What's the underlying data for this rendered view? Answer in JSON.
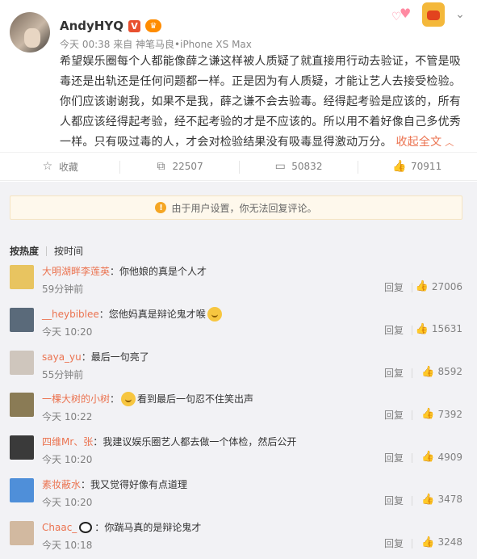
{
  "post": {
    "username": "AndyHYQ",
    "v_badge": "V",
    "vip_badge": "♛",
    "meta": "今天 00:38 来自 神笔马良•iPhone XS Max",
    "text": "希望娱乐圈每个人都能像薛之谦这样被人质疑了就直接用行动去验证，不管是吸毒还是出轨还是任何问题都一样。正是因为有人质疑，才能让艺人去接受检验。你们应该谢谢我，如果不是我，薛之谦不会去验毒。经得起考验是应该的，所有人都应该经得起考验，经不起考验的才是不应该的。所以用不着好像自己多优秀一样。只有吸过毒的人，才会对检验结果没有吸毒显得激动万分。",
    "fold_label": "收起全文",
    "icons": {
      "avatar": "user-avatar",
      "heart": "heart-decoration",
      "fox": "fox-mascot-icon",
      "more": "chevron-down-icon"
    }
  },
  "actions": [
    {
      "name": "favorite",
      "icon": "star-icon",
      "label": "收藏"
    },
    {
      "name": "repost",
      "icon": "repost-icon",
      "label": "22507"
    },
    {
      "name": "comment",
      "icon": "comment-icon",
      "label": "50832"
    },
    {
      "name": "like",
      "icon": "thumbs-up-icon",
      "label": "70911"
    }
  ],
  "notice": {
    "text": "由于用户设置，你无法回复评论。",
    "icon": "warning-icon"
  },
  "sort_tabs": {
    "hot": "按热度",
    "time": "按时间"
  },
  "reply_label": "回复",
  "comments": [
    {
      "user": "大明湖畔李莲英",
      "text": "你他娘的真是个人才",
      "time": "59分钟前",
      "likes": "27006",
      "avatar_color": "#e8c460",
      "emoji": ""
    },
    {
      "user": "__heybiblee",
      "text": "您他妈真是辩论鬼才喉",
      "time": "今天 10:20",
      "likes": "15631",
      "avatar_color": "#5a6a7a",
      "emoji": "grin-emoji"
    },
    {
      "user": "saya_yu",
      "text": "最后一句亮了",
      "time": "55分钟前",
      "likes": "8592",
      "avatar_color": "#cfc6bd",
      "emoji": ""
    },
    {
      "user": "一棵大树的小树",
      "text": "看到最后一句忍不住笑出声",
      "time": "今天 10:22",
      "likes": "7392",
      "avatar_color": "#8a7b55",
      "emoji": "laugh-cry-emoji"
    },
    {
      "user": "四维Mr、张",
      "text": "我建议娱乐圈艺人都去做一个体检，然后公开",
      "time": "今天 10:20",
      "likes": "4909",
      "avatar_color": "#3a3a3a",
      "emoji": ""
    },
    {
      "user": "素妆蔽水",
      "text": "我又觉得好像有点道理",
      "time": "今天 10:20",
      "likes": "3478",
      "avatar_color": "#4f8fd9",
      "emoji": ""
    },
    {
      "user": "Chaac_",
      "text": "你踹马真的是辩论鬼才",
      "time": "今天 10:18",
      "likes": "3248",
      "avatar_color": "#d2b9a0",
      "emoji": "panda-emoji"
    }
  ]
}
